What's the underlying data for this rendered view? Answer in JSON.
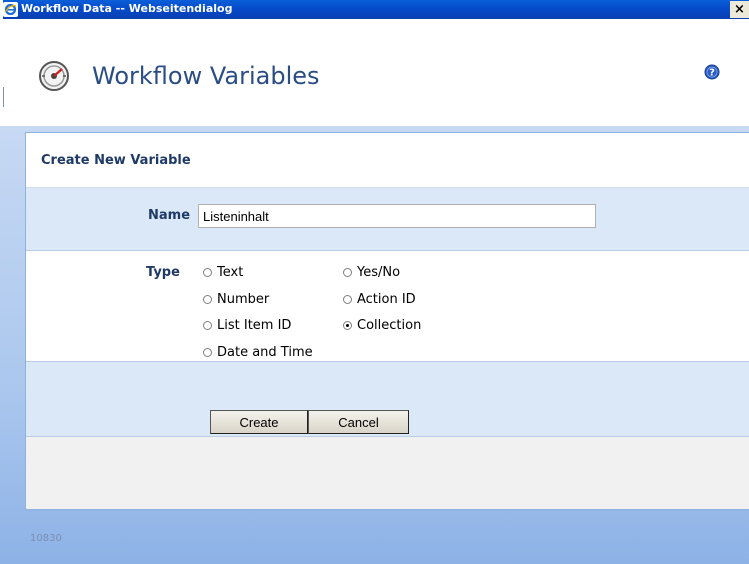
{
  "window": {
    "title": "Workflow Data -- Webseitendialog",
    "close_label": "×"
  },
  "header": {
    "title": "Workflow Variables"
  },
  "form": {
    "title": "Create New Variable",
    "name_label": "Name",
    "name_value": "Listeninhalt",
    "type_label": "Type",
    "type_options": [
      {
        "label": "Text",
        "checked": false
      },
      {
        "label": "Yes/No",
        "checked": false
      },
      {
        "label": "Number",
        "checked": false
      },
      {
        "label": "Action ID",
        "checked": false
      },
      {
        "label": "List Item ID",
        "checked": false
      },
      {
        "label": "Collection",
        "checked": true
      },
      {
        "label": "Date and Time",
        "checked": false
      }
    ],
    "create_label": "Create",
    "cancel_label": "Cancel"
  },
  "footer": {
    "code": "10830"
  },
  "icons": {
    "window_icon": "internet-explorer-icon",
    "workflow_icon": "workflow-gauge-icon",
    "help_icon": "help-icon"
  },
  "colors": {
    "title_bar": "#0549c9",
    "heading_text": "#2a4d85",
    "label_text": "#1f3a66",
    "row_tint": "#dbe8f8"
  }
}
